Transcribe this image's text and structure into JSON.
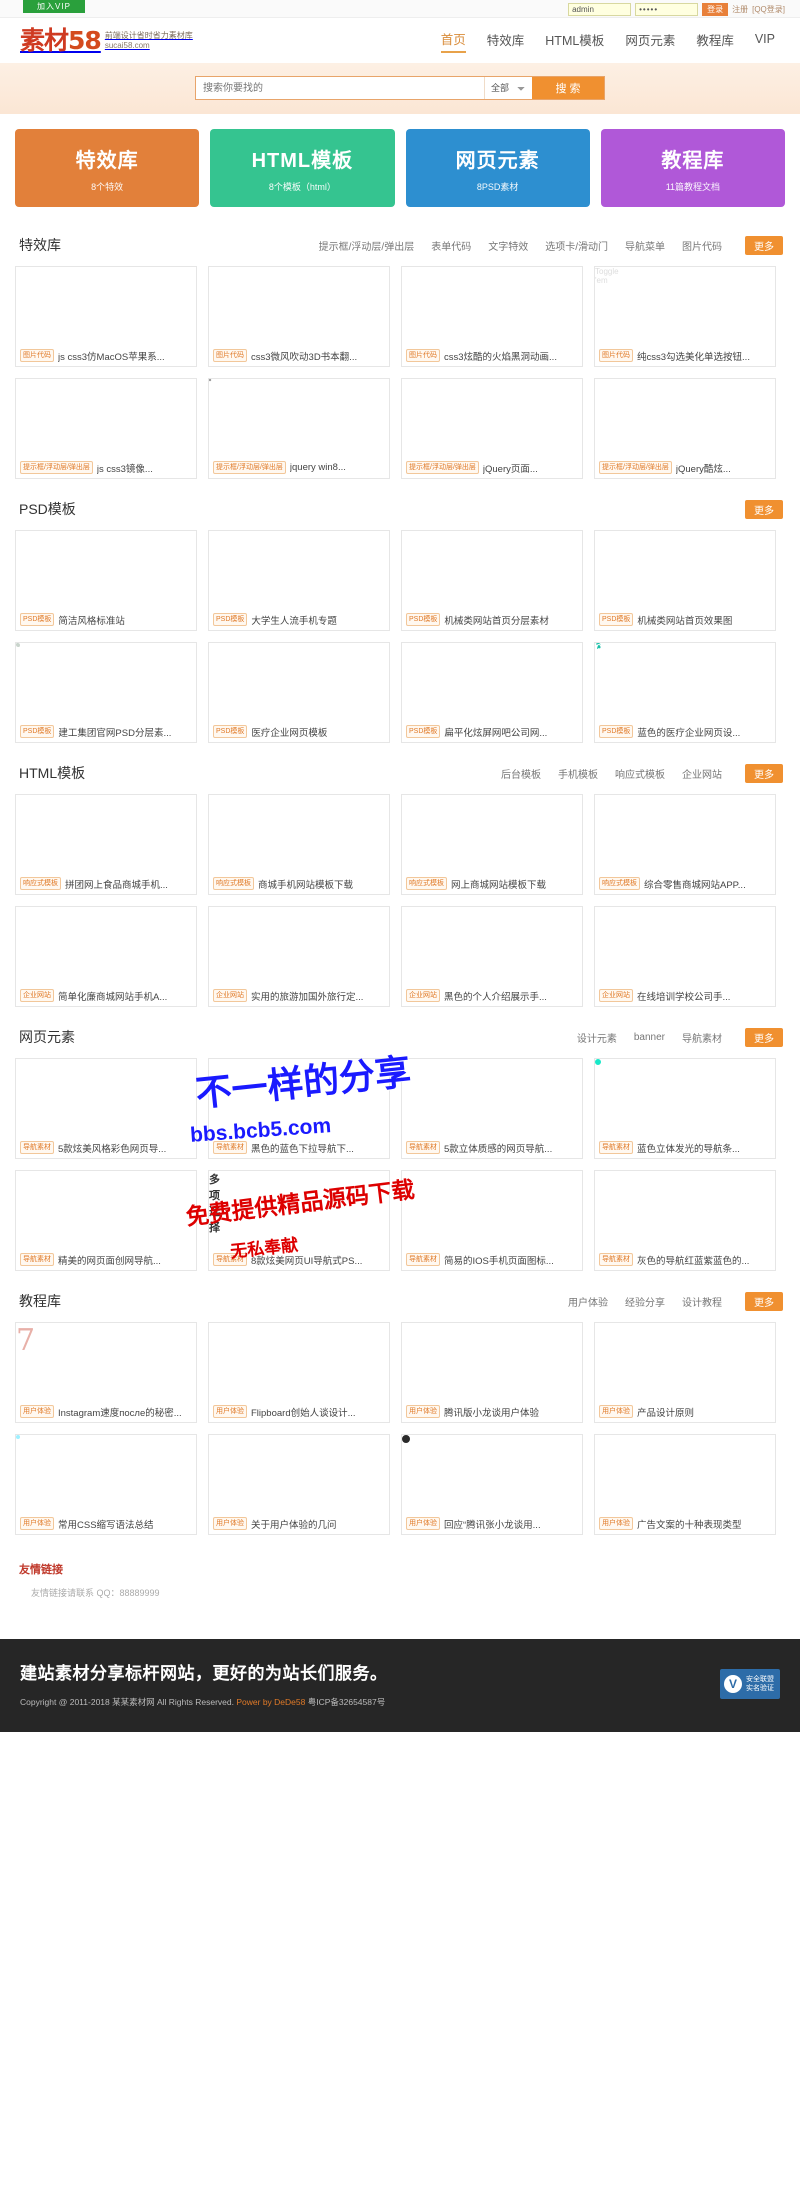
{
  "topbar": {
    "vip_label": "加入VIP",
    "username_value": "admin",
    "password_value": "•••••",
    "login_label": "登录",
    "register_label": "注册",
    "qq_login_label": "[QQ登录]"
  },
  "logo": {
    "mark_text": "素材",
    "mark_num": "58",
    "slogan": "前端设计省时省力素材库",
    "domain": "sucai58.com"
  },
  "nav": [
    {
      "label": "首页",
      "active": true
    },
    {
      "label": "特效库",
      "active": false
    },
    {
      "label": "HTML模板",
      "active": false
    },
    {
      "label": "网页元素",
      "active": false
    },
    {
      "label": "教程库",
      "active": false
    },
    {
      "label": "VIP",
      "active": false
    }
  ],
  "search": {
    "placeholder": "搜索你要找的",
    "scope_selected": "全部",
    "button_label": "搜 索"
  },
  "promos": [
    {
      "title": "特效库",
      "desc": "8个特效",
      "color": "#e2803a"
    },
    {
      "title": "HTML模板",
      "desc": "8个模板（html）",
      "color": "#35c490"
    },
    {
      "title": "网页元素",
      "desc": "8PSD素材",
      "color": "#2d8fd0"
    },
    {
      "title": "教程库",
      "desc": "11篇教程文档",
      "color": "#b058d8"
    }
  ],
  "sections": [
    {
      "title": "特效库",
      "tags": [
        "提示框/浮动层/弹出层",
        "表单代码",
        "文字特效",
        "选项卡/滑动门",
        "导航菜单",
        "图片代码"
      ],
      "more_label": "更多",
      "items": [
        {
          "badge": "图片代码",
          "title": "js css3仿MacOS苹果系...",
          "art": "mac"
        },
        {
          "badge": "图片代码",
          "title": "css3微风吹动3D书本翻...",
          "art": "paper"
        },
        {
          "badge": "图片代码",
          "title": "css3炫酷的火焰黑洞动画...",
          "art": "fire"
        },
        {
          "badge": "图片代码",
          "title": "纯css3勾选美化单选按钮...",
          "art": "radio"
        },
        {
          "badge": "提示框/浮动层/弹出层",
          "title": "js css3镜像...",
          "art": "dark-menu"
        },
        {
          "badge": "提示框/浮动层/弹出层",
          "title": "jquery win8...",
          "art": "poster"
        },
        {
          "badge": "提示框/浮动层/弹出层",
          "title": "jQuery页面...",
          "art": "redgrid"
        },
        {
          "badge": "提示框/浮动层/弹出层",
          "title": "jQuery酷炫...",
          "art": "purple"
        }
      ]
    },
    {
      "title": "PSD模板",
      "tags": [],
      "more_label": "更多",
      "items": [
        {
          "badge": "PSD模板",
          "title": "简洁风格标准站",
          "art": "frog"
        },
        {
          "badge": "PSD模板",
          "title": "大学生人流手机专题",
          "art": "weather"
        },
        {
          "badge": "PSD模板",
          "title": "机械类网站首页分层素材",
          "art": "mobile3"
        },
        {
          "badge": "PSD模板",
          "title": "机械类网站首页效果图",
          "art": "darkui"
        },
        {
          "badge": "PSD模板",
          "title": "建工集团官网PSD分层素...",
          "art": "chalk"
        },
        {
          "badge": "PSD模板",
          "title": "医疗企业网页模板",
          "art": "redweb"
        },
        {
          "badge": "PSD模板",
          "title": "扁平化炫屏网吧公司网...",
          "art": "photog"
        },
        {
          "badge": "PSD模板",
          "title": "蓝色的医疗企业网页设...",
          "art": "timer"
        }
      ]
    },
    {
      "title": "HTML模板",
      "tags": [
        "后台模板",
        "手机模板",
        "响应式模板",
        "企业网站"
      ],
      "more_label": "更多",
      "items": [
        {
          "badge": "响应式模板",
          "title": "拼团网上食品商城手机...",
          "art": "shop"
        },
        {
          "badge": "响应式模板",
          "title": "商城手机网站模板下载",
          "art": "person"
        },
        {
          "badge": "响应式模板",
          "title": "网上商城网站模板下载",
          "art": "blue-s"
        },
        {
          "badge": "响应式模板",
          "title": "综合零售商城网站APP...",
          "art": "promo-red"
        },
        {
          "badge": "企业网站",
          "title": "简单化廉商城网站手机A...",
          "art": "cate"
        },
        {
          "badge": "企业网站",
          "title": "实用的旅游加国外旅行定...",
          "art": "slider"
        },
        {
          "badge": "企业网站",
          "title": "黑色的个人介绍展示手...",
          "art": "food"
        },
        {
          "badge": "企业网站",
          "title": "在线培训学校公司手...",
          "art": "school"
        }
      ]
    },
    {
      "title": "网页元素",
      "tags": [
        "设计元素",
        "banner",
        "导航素材"
      ],
      "more_label": "更多",
      "items": [
        {
          "badge": "导航素材",
          "title": "5款炫美风格彩色网页导...",
          "art": "lotus"
        },
        {
          "badge": "导航素材",
          "title": "黑色的蓝色下拉导航下...",
          "art": "dropdown"
        },
        {
          "badge": "导航素材",
          "title": "5款立体质感的网页导航...",
          "art": "cube"
        },
        {
          "badge": "导航素材",
          "title": "蓝色立体发光的导航条...",
          "art": "spiral"
        },
        {
          "badge": "导航素材",
          "title": "精美的网页面创网导航...",
          "art": "robot"
        },
        {
          "badge": "导航素材",
          "title": "8款炫美网页UI导航式PS...",
          "art": "choice"
        },
        {
          "badge": "导航素材",
          "title": "简易的IOS手机页面图标...",
          "art": "dots"
        },
        {
          "badge": "导航素材",
          "title": "灰色的导航红蓝紫蓝色的...",
          "art": "coffee"
        }
      ]
    },
    {
      "title": "教程库",
      "tags": [
        "用户体验",
        "经验分享",
        "设计教程"
      ],
      "more_label": "更多",
      "items": [
        {
          "badge": "用户体验",
          "title": "Instagram速度после的秘密...",
          "art": "red7"
        },
        {
          "badge": "用户体验",
          "title": "Flipboard创始人谈设计...",
          "art": "flip"
        },
        {
          "badge": "用户体验",
          "title": "腾讯版小龙谈用户体验",
          "art": "clock"
        },
        {
          "badge": "用户体验",
          "title": "产品设计原则",
          "art": "oadi"
        },
        {
          "badge": "用户体验",
          "title": "常用CSS缩写语法总结",
          "art": "cyan"
        },
        {
          "badge": "用户体验",
          "title": "关于用户体验的几问",
          "art": "galaxy"
        },
        {
          "badge": "用户体验",
          "title": "回应“腾讯张小龙谈用...",
          "art": "gauge"
        },
        {
          "badge": "用户体验",
          "title": "广告文案的十种表现类型",
          "art": "colorgrid"
        }
      ]
    }
  ],
  "friend_links": {
    "title": "友情链接",
    "desc": "友情链接请联系 QQ：88889999"
  },
  "watermarks": {
    "line1": "不一样的分享",
    "line2": "bbs.bcb5.com",
    "line3": "免费提供精品源码下载",
    "line4": "无私奉献"
  },
  "footer": {
    "slogan": "建站素材分享标杆网站，更好的为站长们服务。",
    "copyright_pre": "Copyright @ 2011-2018 某某素材网 All Rights Reserved.",
    "power_by": "Power by DeDe58",
    "icp": "粤ICP备32654587号",
    "badge_line1": "安全联盟",
    "badge_line2": "实名验证",
    "badge_mark": "V"
  }
}
